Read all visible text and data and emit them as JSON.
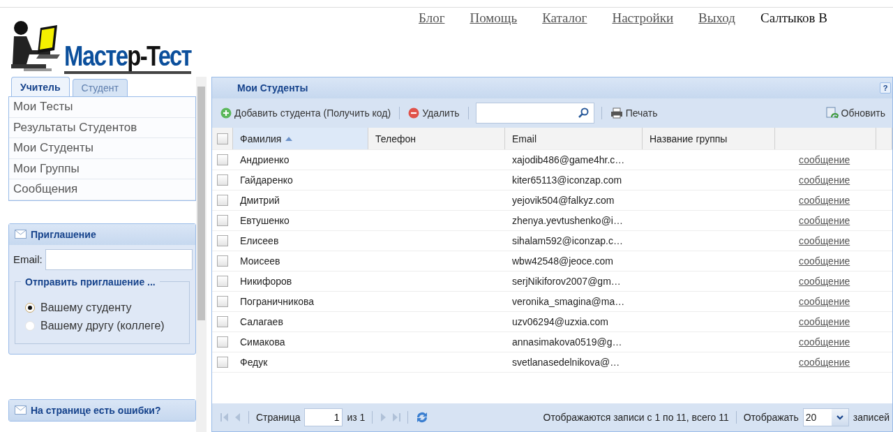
{
  "logo": {
    "parts": [
      {
        "text": "Масте",
        "color": "#0b4f9c"
      },
      {
        "text": "р-Т",
        "color": "#111111"
      },
      {
        "text": "ест",
        "color": "#0b4f9c"
      }
    ]
  },
  "top_nav": {
    "links": [
      "Блог",
      "Помощь",
      "Каталог",
      "Настройки",
      "Выход"
    ],
    "user": "Салтыков В"
  },
  "sidebar": {
    "tabs": [
      {
        "label": "Учитель",
        "selected": true
      },
      {
        "label": "Студент",
        "selected": false
      }
    ],
    "menu": [
      "Мои Тесты",
      "Результаты Студентов",
      "Мои Студенты",
      "Мои Группы",
      "Сообщения"
    ],
    "invite": {
      "title": "Приглашение",
      "email_label": "Email:",
      "group_title": "Отправить приглашение ...",
      "options": [
        {
          "label": "Вашему студенту",
          "selected": true
        },
        {
          "label": "Вашему другу (коллеге)",
          "selected": false
        }
      ]
    },
    "errors_panel": {
      "title": "На странице есть ошибки?"
    }
  },
  "panel": {
    "title": "Мои Студенты",
    "help": "?",
    "select_all_checked": false,
    "toolbar": {
      "add": "Добавить студента (Получить код)",
      "delete": "Удалить",
      "print": "Печать",
      "refresh": "Обновить"
    },
    "columns": [
      "Фамилия",
      "Телефон",
      "Email",
      "Название группы"
    ],
    "rows": [
      {
        "name": "Андриенко",
        "email": "xajodib486@game4hr.c…",
        "link": "сообщение",
        "checked": false
      },
      {
        "name": "Гайдаренко",
        "email": "kiter65113@iconzap.com",
        "link": "сообщение",
        "checked": false
      },
      {
        "name": "Дмитрий",
        "email": "yejovik504@falkyz.com",
        "link": "сообщение",
        "checked": false
      },
      {
        "name": "Евтушенко",
        "email": "zhenya.yevtushenko@i…",
        "link": "сообщение",
        "checked": false
      },
      {
        "name": "Елисеев",
        "email": "sihalam592@iconzap.c…",
        "link": "сообщение",
        "checked": false
      },
      {
        "name": "Моисеев",
        "email": "wbw42548@jeoce.com",
        "link": "сообщение",
        "checked": false
      },
      {
        "name": "Никифоров",
        "email": "serjNikiforov2007@gm…",
        "link": "сообщение",
        "checked": false
      },
      {
        "name": "Пограничникова",
        "email": "veronika_smagina@ma…",
        "link": "сообщение",
        "checked": false
      },
      {
        "name": "Салагаев",
        "email": "uzv06294@uzxia.com",
        "link": "сообщение",
        "checked": false
      },
      {
        "name": "Симакова",
        "email": "annasimakova0519@g…",
        "link": "сообщение",
        "checked": false
      },
      {
        "name": "Федук",
        "email": "svetlanasedelnikova@…",
        "link": "сообщение",
        "checked": false
      }
    ],
    "pager": {
      "page_label": "Страница",
      "page": "1",
      "of": "из 1",
      "status": "Отображаются записи с 1 по 11, всего 11",
      "show_label": "Отображать",
      "page_size": "20",
      "records": "записей"
    }
  }
}
